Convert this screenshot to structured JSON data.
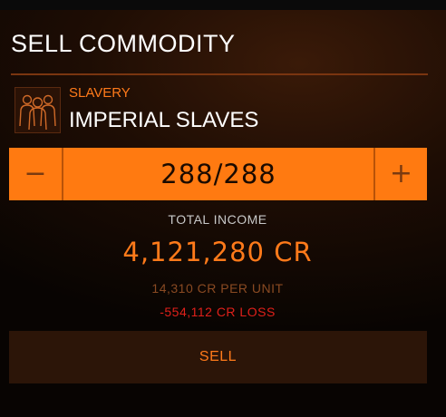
{
  "panel": {
    "title": "SELL COMMODITY"
  },
  "commodity": {
    "category": "SLAVERY",
    "name": "IMPERIAL SLAVES",
    "icon": "people-silhouette-icon"
  },
  "quantity": {
    "display": "288/288",
    "selected": 288,
    "max": 288,
    "decrement_label": "−",
    "increment_label": "+"
  },
  "income": {
    "label": "TOTAL INCOME",
    "total": "4,121,280 CR",
    "per_unit": "14,310 CR PER UNIT",
    "loss": "-554,112 CR LOSS"
  },
  "actions": {
    "sell_label": "SELL"
  },
  "colors": {
    "accent": "#ff7a11",
    "loss": "#e0201a",
    "background": "#1e0d04"
  }
}
